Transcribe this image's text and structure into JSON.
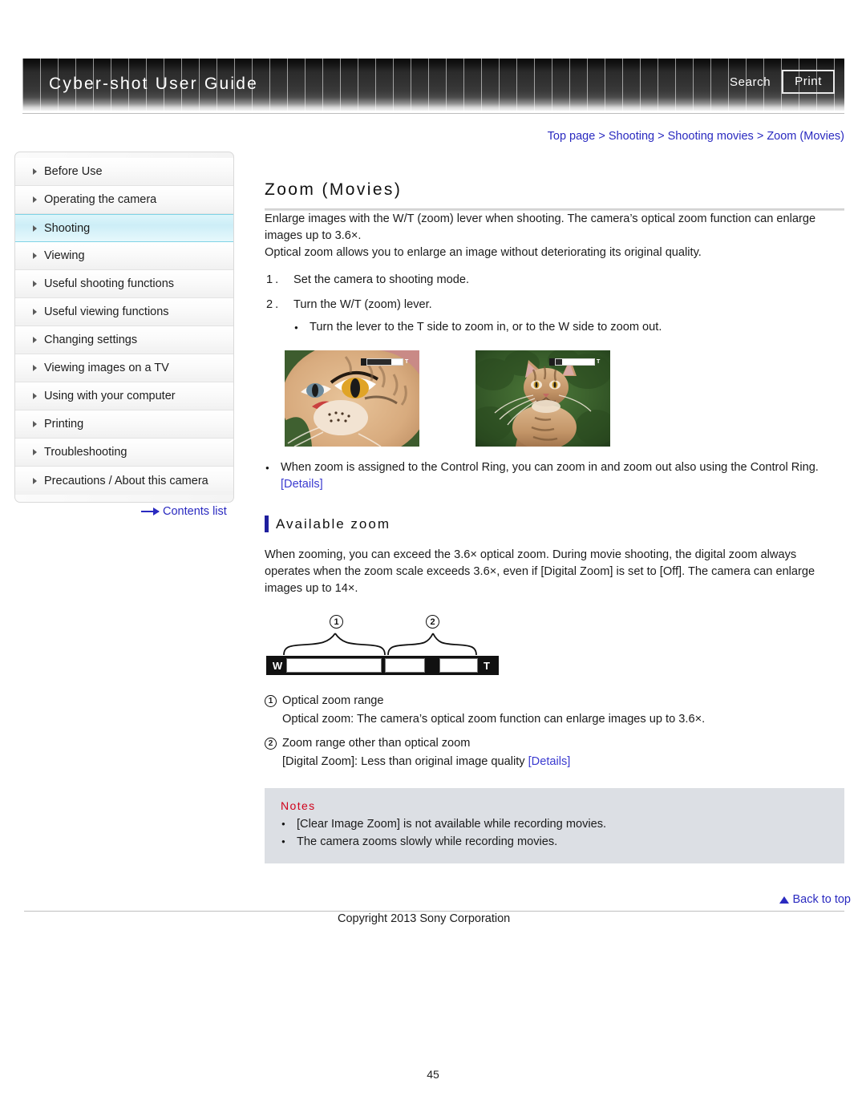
{
  "header": {
    "title": "Cyber-shot User Guide",
    "search_label": "Search",
    "print_label": "Print"
  },
  "breadcrumb": {
    "text": "Top page > Shooting > Shooting movies > Zoom (Movies)"
  },
  "sidebar": {
    "items": [
      {
        "label": "Before Use",
        "active": false
      },
      {
        "label": "Operating the camera",
        "active": false
      },
      {
        "label": "Shooting",
        "active": true
      },
      {
        "label": "Viewing",
        "active": false
      },
      {
        "label": "Useful shooting functions",
        "active": false
      },
      {
        "label": "Useful viewing functions",
        "active": false
      },
      {
        "label": "Changing settings",
        "active": false
      },
      {
        "label": "Viewing images on a TV",
        "active": false
      },
      {
        "label": "Using with your computer",
        "active": false
      },
      {
        "label": "Printing",
        "active": false
      },
      {
        "label": "Troubleshooting",
        "active": false
      },
      {
        "label": "Precautions / About this camera",
        "active": false
      }
    ],
    "contents_list_label": "Contents list"
  },
  "main": {
    "page_title": "Zoom (Movies)",
    "intro_paragraph_1": "Enlarge images with the W/T (zoom) lever when shooting. The camera’s optical zoom function can enlarge images up to 3.6×.",
    "intro_paragraph_2": "Optical zoom allows you to enlarge an image without deteriorating its original quality.",
    "steps": [
      {
        "num": "1.",
        "text": "Set the camera to shooting mode."
      },
      {
        "num": "2.",
        "text": "Turn the W/T (zoom) lever."
      }
    ],
    "step2_bullet": "Turn the lever to the T side to zoom in, or to the W side to zoom out.",
    "photos": [
      {
        "caption_zoom_marker": "T",
        "alt": "cat-close-up-zoomed-in"
      },
      {
        "caption_zoom_marker": "T",
        "alt": "cat-full-body-zoomed-out"
      }
    ],
    "control_ring_bullet": "When zoom is assigned to the Control Ring, you can zoom in and zoom out also using the Control Ring. ",
    "control_ring_link": "[Details]",
    "section_title": "Available zoom",
    "available_zoom_paragraph": "When zooming, you can exceed the 3.6× optical zoom. During movie shooting, the digital zoom always operates when the zoom scale exceeds 3.6×, even if [Digital Zoom] is set to [Off]. The camera can enlarge images up to 14×.",
    "diagram": {
      "marker_1": "1",
      "marker_2": "2",
      "w_label": "W",
      "t_label": "T"
    },
    "explanations": [
      {
        "num": "1",
        "title": "Optical zoom range",
        "detail": "Optical zoom: The camera’s optical zoom function can enlarge images up to 3.6×.",
        "link": ""
      },
      {
        "num": "2",
        "title": "Zoom range other than optical zoom",
        "detail": "[Digital Zoom]: Less than original image quality ",
        "link": "[Details]"
      }
    ],
    "notes": {
      "title": "Notes",
      "items": [
        "[Clear Image Zoom] is not available while recording movies.",
        "The camera zooms slowly while recording movies."
      ]
    }
  },
  "footer": {
    "back_to_top": "Back to top",
    "copyright": "Copyright 2013 Sony Corporation",
    "page_number": "45"
  },
  "colors": {
    "link": "#2a2ac0",
    "accent_bar": "#1f1f9e",
    "notes_title": "#d0021b",
    "notes_bg": "#dcdfe4",
    "active_nav": "#cdeef7"
  }
}
